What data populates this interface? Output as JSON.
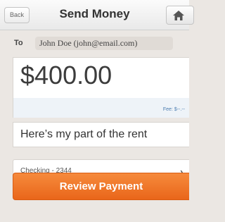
{
  "navbar": {
    "back_label": "Back",
    "title": "Send Money",
    "home_icon": "home-icon"
  },
  "recipient": {
    "to_label": "To",
    "value": "John Doe (john@email.com)"
  },
  "amount": {
    "value": "$400.00",
    "fee": "Fee: $--.--"
  },
  "memo": {
    "value": "Here’s my part of the rent"
  },
  "account": {
    "value": "Checking - 2344",
    "chevron": "›"
  },
  "actions": {
    "review_label": "Review Payment"
  },
  "colors": {
    "accent": "#ef7428",
    "background": "#ebe7e3",
    "fee_text": "#4a7cb0"
  }
}
